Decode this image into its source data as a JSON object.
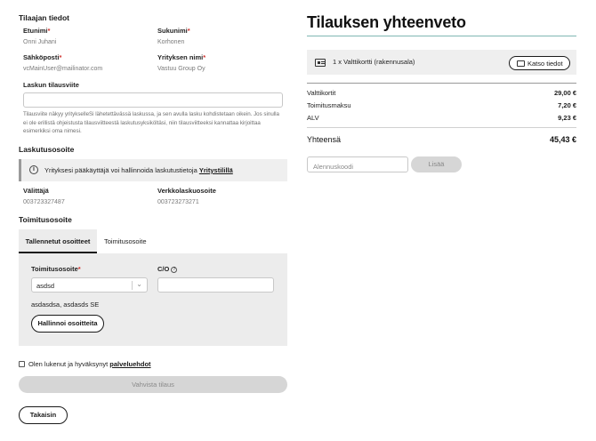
{
  "orderer": {
    "title": "Tilaajan tiedot",
    "first_name_label": "Etunimi",
    "first_name_value": "Onni Juhani",
    "last_name_label": "Sukunimi",
    "last_name_value": "Korhonen",
    "email_label": "Sähköposti",
    "email_value": "vcMainUser@mailinator.com",
    "company_label": "Yrityksen nimi",
    "company_value": "Vastuu Group Oy",
    "reference_label": "Laskun tilausviite",
    "reference_value": "",
    "reference_help": "Tilausviite näkyy yritykselleSi lähetettävässä laskussa, ja sen avulla lasku kohdistetaan oikein. Jos sinulla ei ole erillistä ohjeistusta tilausviitteestä laskutusyksiköltäsi, niin tilausviitteeksi kannattaa kirjoittaa esimerkiksi oma nimesi.",
    "required_mark": "*"
  },
  "billing": {
    "title": "Laskutusosoite",
    "info_icon": "i",
    "info_text": "Yrityksesi pääkäyttäjä voi hallinnoida laskutustietoja ",
    "info_link": "Yritystilillä",
    "operator_label": "Välittäjä",
    "operator_value": "003723327487",
    "einvoice_label": "Verkkolaskuosoite",
    "einvoice_value": "003723273271"
  },
  "delivery": {
    "title": "Toimitusosoite",
    "tabs": [
      {
        "label": "Tallennetut osoitteet",
        "active": true
      },
      {
        "label": "Toimitusosoite",
        "active": false
      }
    ],
    "address_label": "Toimitusosoite",
    "address_selected": "asdsd",
    "co_label": "C/O",
    "co_value": "",
    "address_summary": "asdasdsa, asdasds SE",
    "manage_button": "Hallinnoi osoitteita"
  },
  "terms": {
    "checked": false,
    "text": "Olen lukenut ja hyväksynyt ",
    "link": "palveluehdot"
  },
  "actions": {
    "confirm": "Vahvista tilaus",
    "back": "Takaisin"
  },
  "summary": {
    "title": "Tilauksen yhteenveto",
    "product_text": "1 x Valttikortti (rakennusala)",
    "details_button": "Katso tiedot",
    "rows": [
      {
        "label": "Valttikortit",
        "value": "29,00 €"
      },
      {
        "label": "Toimitusmaksu",
        "value": "7,20 €"
      },
      {
        "label": "ALV",
        "value": "9,23 €"
      }
    ],
    "total_label": "Yhteensä",
    "total_value": "45,43 €",
    "coupon_placeholder": "Alennuskoodi",
    "coupon_button": "Lisää"
  },
  "colors": {
    "accent_rule": "#7fb7b3",
    "required": "#d0312d",
    "disabled_button": "#d6d6d6"
  }
}
